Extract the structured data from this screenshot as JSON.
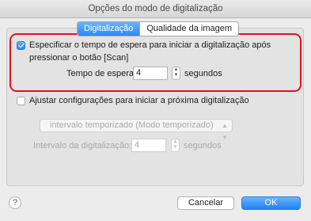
{
  "window": {
    "title": "Opções do modo de digitalização"
  },
  "tabs": [
    {
      "label": "Digitalização",
      "active": true
    },
    {
      "label": "Qualidade da imagem",
      "active": false
    }
  ],
  "scan_wait": {
    "checked": true,
    "label_line1": "Especificar o tempo de espera para iniciar a digitalização após",
    "label_line2": "pressionar o botão [Scan]",
    "wait_label": "Tempo de espera:",
    "wait_value": "4",
    "wait_unit": "segundos"
  },
  "next_scan": {
    "checked": false,
    "label": "Ajustar configurações para iniciar a próxima digitalização",
    "mode_selected": "intervalo temporizado (Modo temporizado)",
    "interval_label": "Intervalo da digitalização:",
    "interval_value": "4",
    "interval_unit": "segundos"
  },
  "buttons": {
    "help": "?",
    "cancel": "Cancelar",
    "ok": "OK"
  },
  "colors": {
    "accent": "#2a89f5",
    "highlight": "#e0141d"
  }
}
